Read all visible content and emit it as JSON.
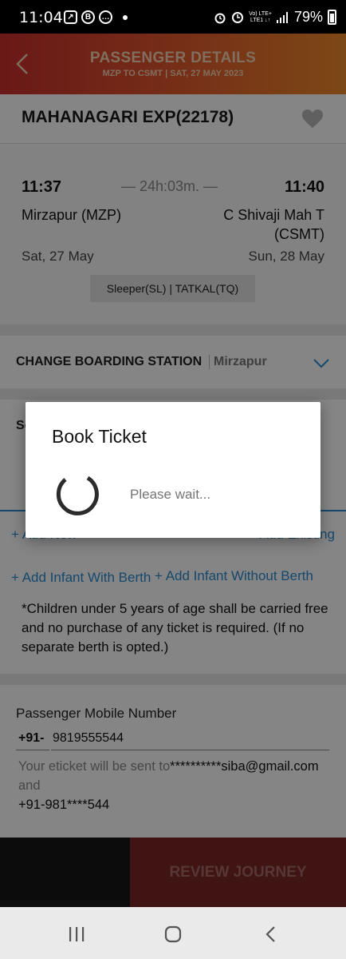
{
  "status_bar": {
    "time": "11:04",
    "network_top": "Vo) LTE+",
    "network_bottom": "LTE1 ↓↑",
    "battery": "79%"
  },
  "header": {
    "title": "PASSENGER DETAILS",
    "subtitle": "MZP TO CSMT |  SAT, 27 MAY  2023"
  },
  "train": {
    "name": "MAHANAGARI EXP(22178)"
  },
  "journey": {
    "departure_time": "11:37",
    "duration": "— 24h:03m. —",
    "arrival_time": "11:40",
    "from_station": "Mirzapur (MZP)",
    "to_station": "C Shivaji Mah T (CSMT)",
    "departure_date": "Sat, 27 May",
    "arrival_date": "Sun, 28 May",
    "class_quota": "Sleeper(SL) | TATKAL(TQ)"
  },
  "boarding": {
    "label": "CHANGE BOARDING STATION",
    "value": "Mirzapur"
  },
  "passengers": {
    "section_label": "Se",
    "add_new": "+ Add New",
    "add_existing": "+ Add Existing",
    "add_infant_with_berth": "+ Add Infant With Berth",
    "add_infant_without_berth": "+ Add Infant Without Berth",
    "note": "*Children under 5 years of age shall be carried free and no purchase of any ticket is required. (If no separate berth is opted.)"
  },
  "contact": {
    "label": "Passenger Mobile Number",
    "country_code": "+91-",
    "mobile": "9819555544",
    "eticket_prefix": "Your eticket will be sent to",
    "email": "**********siba@gmail.com",
    "eticket_and": " and",
    "phone_masked": "+91-981****544"
  },
  "footer": {
    "review_button": "REVIEW JOURNEY"
  },
  "dialog": {
    "title": "Book Ticket",
    "message": "Please wait..."
  },
  "colors": {
    "header_gradient_start": "#c9302c",
    "header_gradient_end": "#ef8a2b",
    "link_blue": "#2a8bd1",
    "review_bg": "#c7403a"
  }
}
